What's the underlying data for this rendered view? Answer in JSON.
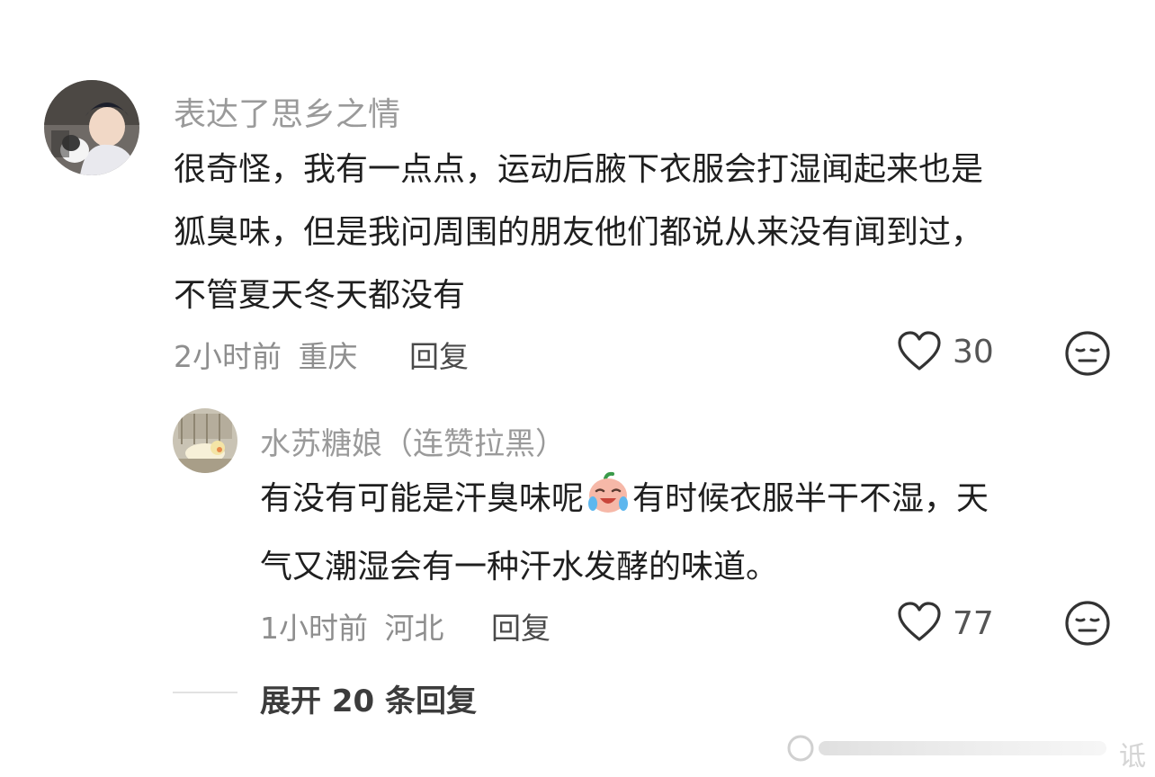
{
  "comments": [
    {
      "username": "表达了思乡之情",
      "text_lines": [
        "很奇怪，我有一点点，运动后腋下衣服会打湿闻起来也是",
        "狐臭味，但是我问周围的朋友他们都说从来没有闻到过，",
        "不管夏天冬天都没有"
      ],
      "time": "2小时前",
      "location": "重庆",
      "reply_label": "回复",
      "likes": "30"
    }
  ],
  "replies": [
    {
      "username": "水苏糖娘（连赞拉黑）",
      "text_line1_before_emoji": "有没有可能是汗臭味呢",
      "emoji": "crying-laughing-emoji",
      "text_line1_after_emoji": "有时候衣服半干不湿，天",
      "text_line2": "气又潮湿会有一种汗水发酵的味道。",
      "time": "1小时前",
      "location": "河北",
      "reply_label": "回复",
      "likes": "77"
    }
  ],
  "expand": {
    "label": "展开 20 条回复"
  },
  "watermark": {
    "text": "诋"
  },
  "colors": {
    "text": "#1f1f1f",
    "muted": "#8e8e8e",
    "icon": "#333333"
  }
}
